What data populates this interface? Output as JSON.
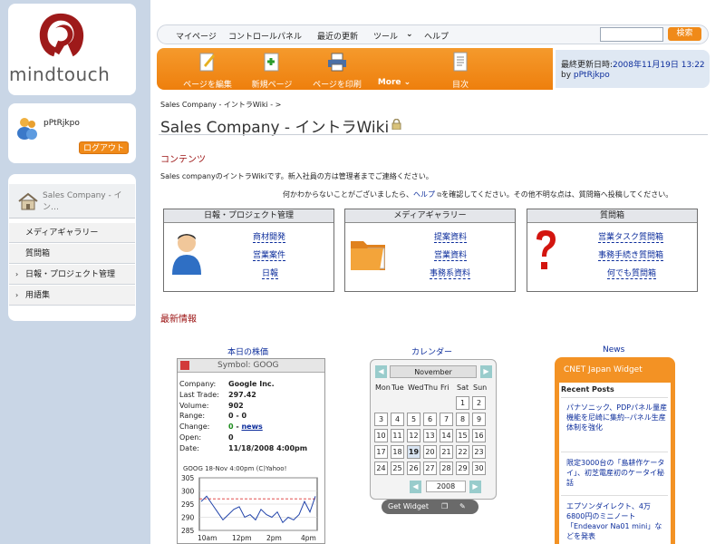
{
  "logo": {
    "text": "mindtouch"
  },
  "user": {
    "name": "pPtRjkpo",
    "logout_label": "ログアウト"
  },
  "nav": {
    "current": "Sales Company - イン…",
    "items": [
      {
        "label": "メディアギャラリー",
        "arrow": ""
      },
      {
        "label": "質問箱",
        "arrow": ""
      },
      {
        "label": "日報・プロジェクト管理",
        "arrow": "›"
      },
      {
        "label": "用語集",
        "arrow": "›"
      }
    ]
  },
  "topbar": {
    "links": [
      "マイページ",
      "コントロールパネル",
      "最近の更新",
      "ツール",
      "ヘルプ"
    ],
    "tool_arrow": "⌄",
    "search_placeholder": "",
    "search_label": "検索"
  },
  "toolbar": {
    "edit_label": "ページを編集",
    "new_label": "新規ページ",
    "print_label": "ページを印刷",
    "more_label": "More ⌄",
    "toc_label": "目次"
  },
  "info": {
    "updated_label": "最終更新日時:",
    "updated_value": "2008年11月19日 13:22",
    "by_label": "by",
    "by_user": "pPtRjkpo"
  },
  "breadcrumb": "Sales Company - イントラWiki - >",
  "page_title": "Sales Company - イントラWiki -",
  "contents": {
    "heading": "コンテンツ",
    "intro1": "Sales companyのイントラWikiです。新入社員の方は管理者までご連絡ください。",
    "intro2_a": "何かわからないことがございましたら、",
    "intro2_link": "ヘルプ",
    "intro2_b": "を確認してください。その他不明な点は、質問箱へ投稿してください。"
  },
  "panels": [
    {
      "title": "日報・プロジェクト管理",
      "links": [
        "商材開発",
        "営業案件",
        "日報"
      ]
    },
    {
      "title": "メディアギャラリー",
      "links": [
        "提案資料",
        "営業資料",
        "事務系資料"
      ]
    },
    {
      "title": "質問箱",
      "links": [
        "営業タスク質問箱",
        "事務手続き質問箱",
        "何でも質問箱"
      ]
    }
  ],
  "news_heading": "最新情報",
  "stock": {
    "title": "本日の株価",
    "symbol": "Symbol: GOOG",
    "rows": [
      {
        "key": "Company:",
        "value": "Google Inc."
      },
      {
        "key": "Last Trade:",
        "value": "297.42"
      },
      {
        "key": "Volume:",
        "value": "902"
      },
      {
        "key": "Range:",
        "value": "0 - 0"
      },
      {
        "key": "Change:",
        "value_prefix": "0",
        "value_dash": " - ",
        "value_link": "news"
      },
      {
        "key": "Open:",
        "value": "0"
      },
      {
        "key": "Date:",
        "value": "11/18/2008 4:00pm"
      }
    ]
  },
  "chart_data": {
    "type": "line",
    "title": "GOOG 18-Nov 4:00pm (C)Yahoo!",
    "x": [
      "10am",
      "12pm",
      "2pm",
      "4pm"
    ],
    "ylim": [
      285,
      305
    ],
    "yticks": [
      305,
      300,
      295,
      290,
      285
    ],
    "reference": 297,
    "series": [
      {
        "values": [
          296,
          298,
          295,
          292,
          289,
          291,
          293,
          294,
          290,
          291,
          289,
          293,
          291,
          290,
          292,
          288,
          290,
          289,
          291,
          296,
          292,
          298
        ]
      }
    ]
  },
  "calendar": {
    "title": "カレンダー",
    "month": "November",
    "year": "2008",
    "dow": [
      "Mon",
      "Tue",
      "Wed",
      "Thu",
      "Fri",
      "Sat",
      "Sun"
    ],
    "weeks": [
      [
        "",
        "",
        "",
        "",
        "",
        "1",
        "2"
      ],
      [
        "3",
        "4",
        "5",
        "6",
        "7",
        "8",
        "9"
      ],
      [
        "10",
        "11",
        "12",
        "13",
        "14",
        "15",
        "16"
      ],
      [
        "17",
        "18",
        "19",
        "20",
        "21",
        "22",
        "23"
      ],
      [
        "24",
        "25",
        "26",
        "27",
        "28",
        "29",
        "30"
      ]
    ],
    "today": "19",
    "get_widget": "Get Widget"
  },
  "news": {
    "title": "News",
    "widget_title": "CNET Japan Widget",
    "recent_posts": "Recent Posts",
    "items": [
      "パナソニック、PDPパネル量産機能を尼崎に集約--パネル生産体制を強化",
      "限定3000台の「島耕作ケータイ」、初芝電産初のケータイ秘話",
      "エプソンダイレクト、4万6800円のミニノート「Endeavor Na01 mini」などを発表"
    ]
  },
  "colors": {
    "accent": "#f08a19",
    "link": "#0b2c9b",
    "heading": "#9b1111"
  }
}
